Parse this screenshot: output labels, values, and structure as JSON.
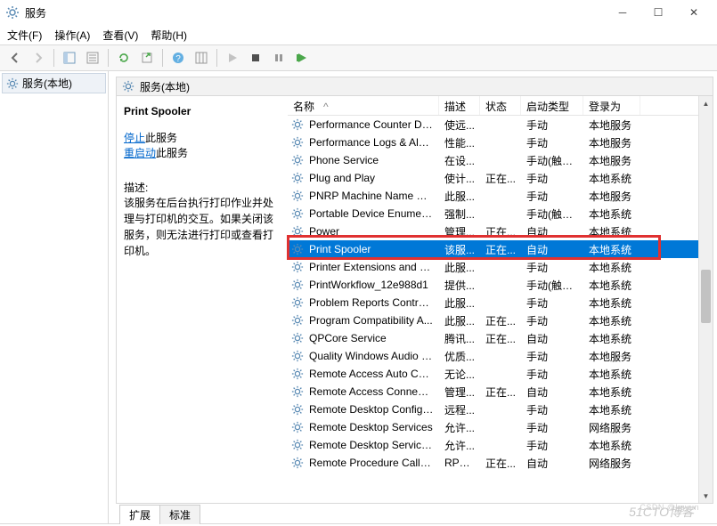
{
  "window": {
    "title": "服务"
  },
  "menu": {
    "file": "文件(F)",
    "action": "操作(A)",
    "view": "查看(V)",
    "help": "帮助(H)"
  },
  "tree": {
    "root": "服务(本地)"
  },
  "header_tab": "服务(本地)",
  "detail": {
    "title": "Print Spooler",
    "stop_prefix": "停止",
    "stop_suffix": "此服务",
    "restart_prefix": "重启动",
    "restart_suffix": "此服务",
    "desc_label": "描述:",
    "desc_body": "该服务在后台执行打印作业并处理与打印机的交互。如果关闭该服务，则无法进行打印或查看打印机。"
  },
  "columns": {
    "name": "名称",
    "desc": "描述",
    "status": "状态",
    "startup": "启动类型",
    "logon": "登录为"
  },
  "services": [
    {
      "name": "Performance Counter DL...",
      "desc": "使远...",
      "status": "",
      "startup": "手动",
      "logon": "本地服务"
    },
    {
      "name": "Performance Logs & Aler...",
      "desc": "性能...",
      "status": "",
      "startup": "手动",
      "logon": "本地服务"
    },
    {
      "name": "Phone Service",
      "desc": "在设...",
      "status": "",
      "startup": "手动(触发...",
      "logon": "本地服务"
    },
    {
      "name": "Plug and Play",
      "desc": "使计...",
      "status": "正在...",
      "startup": "手动",
      "logon": "本地系统"
    },
    {
      "name": "PNRP Machine Name Pu...",
      "desc": "此服...",
      "status": "",
      "startup": "手动",
      "logon": "本地服务"
    },
    {
      "name": "Portable Device Enumera...",
      "desc": "强制...",
      "status": "",
      "startup": "手动(触发...",
      "logon": "本地系统"
    },
    {
      "name": "Power",
      "desc": "管理...",
      "status": "正在...",
      "startup": "自动",
      "logon": "本地系统"
    },
    {
      "name": "Print Spooler",
      "desc": "该服...",
      "status": "正在...",
      "startup": "自动",
      "logon": "本地系统",
      "selected": true
    },
    {
      "name": "Printer Extensions and N...",
      "desc": "此服...",
      "status": "",
      "startup": "手动",
      "logon": "本地系统"
    },
    {
      "name": "PrintWorkflow_12e988d1",
      "desc": "提供...",
      "status": "",
      "startup": "手动(触发...",
      "logon": "本地系统"
    },
    {
      "name": "Problem Reports Control...",
      "desc": "此服...",
      "status": "",
      "startup": "手动",
      "logon": "本地系统"
    },
    {
      "name": "Program Compatibility A...",
      "desc": "此服...",
      "status": "正在...",
      "startup": "手动",
      "logon": "本地系统"
    },
    {
      "name": "QPCore Service",
      "desc": "腾讯...",
      "status": "正在...",
      "startup": "自动",
      "logon": "本地系统"
    },
    {
      "name": "Quality Windows Audio V...",
      "desc": "优质...",
      "status": "",
      "startup": "手动",
      "logon": "本地服务"
    },
    {
      "name": "Remote Access Auto Con...",
      "desc": "无论...",
      "status": "",
      "startup": "手动",
      "logon": "本地系统"
    },
    {
      "name": "Remote Access Connecti...",
      "desc": "管理...",
      "status": "正在...",
      "startup": "自动",
      "logon": "本地系统"
    },
    {
      "name": "Remote Desktop Configu...",
      "desc": "远程...",
      "status": "",
      "startup": "手动",
      "logon": "本地系统"
    },
    {
      "name": "Remote Desktop Services",
      "desc": "允许...",
      "status": "",
      "startup": "手动",
      "logon": "网络服务"
    },
    {
      "name": "Remote Desktop Service...",
      "desc": "允许...",
      "status": "",
      "startup": "手动",
      "logon": "本地系统"
    },
    {
      "name": "Remote Procedure Call (...",
      "desc": "RPC...",
      "status": "正在...",
      "startup": "自动",
      "logon": "网络服务"
    }
  ],
  "tabs": {
    "extended": "扩展",
    "standard": "标准"
  },
  "watermark": "51CTO博客",
  "credit": "CSDN @kgyun"
}
